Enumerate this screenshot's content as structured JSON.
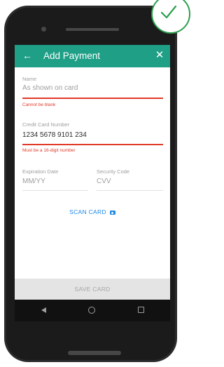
{
  "toolbar": {
    "title": "Add Payment",
    "back_icon": "arrow-left",
    "close_icon": "close-x",
    "color": "#1e9f86"
  },
  "name_field": {
    "label": "Name",
    "placeholder": "As shown on card",
    "error": "Cannot be blank"
  },
  "card_field": {
    "label": "Credit Card Number",
    "value": "1234 5678 9101 234",
    "error": "Must be a 16-digit number"
  },
  "expiration_field": {
    "label": "Expiration Date",
    "placeholder": "MM/YY"
  },
  "security_field": {
    "label": "Security Code",
    "placeholder": "CVV"
  },
  "scan": {
    "label": "SCAN CARD",
    "icon": "camera-icon",
    "color": "#1e88e5"
  },
  "save": {
    "label": "SAVE CARD"
  },
  "nav": {
    "back": "back-icon",
    "home": "home-icon",
    "recent": "recent-apps-icon"
  },
  "badge": {
    "icon": "check-icon",
    "color": "#2e9e4f"
  },
  "error_color": "#e03a2a"
}
